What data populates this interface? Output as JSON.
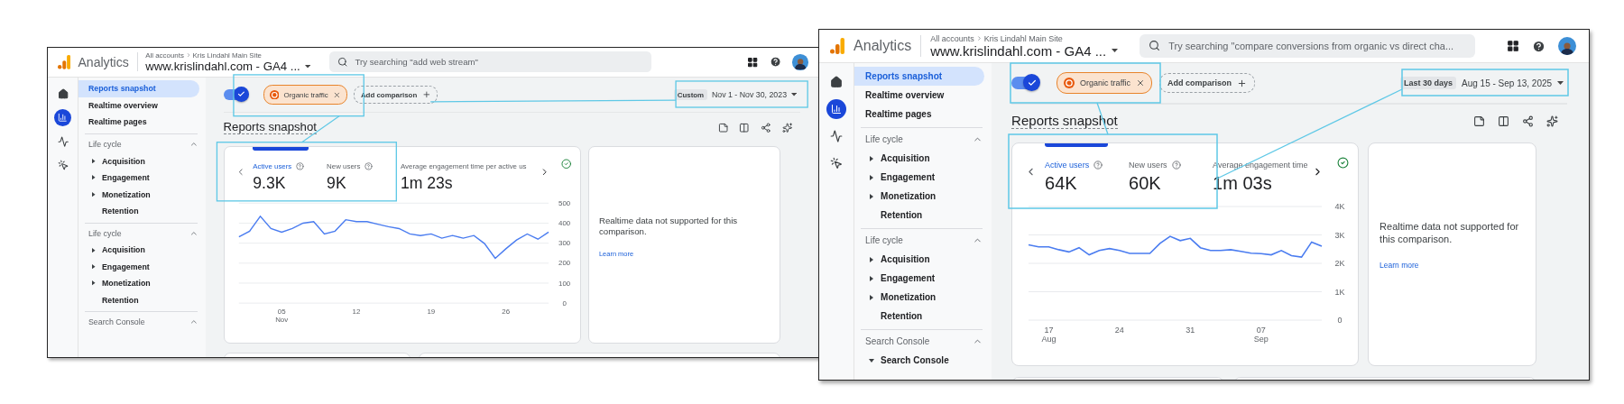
{
  "panels": [
    {
      "header": {
        "app_name": "Analytics",
        "breadcrumb": [
          "All accounts",
          "Kris Lindahl Main Site"
        ],
        "property": "www.krislindahl.com - GA4 ...",
        "search_placeholder": "Try searching \"add web stream\""
      },
      "rail": [
        {
          "kind": "home",
          "selected": false
        },
        {
          "kind": "reports",
          "selected": true
        },
        {
          "kind": "explore",
          "selected": false
        },
        {
          "kind": "advertising",
          "selected": false
        }
      ],
      "nav": {
        "items": [
          {
            "label": "Reports snapshot",
            "selected": true
          },
          {
            "label": "Realtime overview",
            "selected": false
          },
          {
            "label": "Realtime pages",
            "selected": false
          }
        ],
        "sections": [
          {
            "title": "Life cycle",
            "expanded": true,
            "items": [
              {
                "label": "Acquisition",
                "kind": "group",
                "expanded": false
              },
              {
                "label": "Engagement",
                "kind": "group",
                "expanded": false
              },
              {
                "label": "Monetization",
                "kind": "group",
                "expanded": false
              },
              {
                "label": "Retention",
                "kind": "page"
              }
            ]
          },
          {
            "title": "Life cycle",
            "expanded": true,
            "items": [
              {
                "label": "Acquisition",
                "kind": "group",
                "expanded": false
              },
              {
                "label": "Engagement",
                "kind": "group",
                "expanded": false
              },
              {
                "label": "Monetization",
                "kind": "group",
                "expanded": false
              },
              {
                "label": "Retention",
                "kind": "page"
              }
            ]
          },
          {
            "title": "Search Console",
            "expanded": true
          }
        ]
      },
      "comparison": {
        "enabled": true,
        "chips": [
          {
            "label": "Organic traffic"
          }
        ],
        "add_label": "Add comparison"
      },
      "date_range": {
        "preset": "Custom",
        "range": "Nov 1 - Nov 30, 2023"
      },
      "title": "Reports snapshot",
      "metrics": [
        {
          "label": "Active users",
          "value": "9.3K",
          "selected": true,
          "help": true
        },
        {
          "label": "New users",
          "value": "9K",
          "selected": false,
          "help": true
        },
        {
          "label": "Average engagement time per active us",
          "value": "1m 23s",
          "selected": false,
          "help": false
        }
      ],
      "chart_data": {
        "type": "line",
        "x": [
          "2023-11-01",
          "2023-11-02",
          "2023-11-03",
          "2023-11-04",
          "2023-11-05",
          "2023-11-06",
          "2023-11-07",
          "2023-11-08",
          "2023-11-09",
          "2023-11-10",
          "2023-11-11",
          "2023-11-12",
          "2023-11-13",
          "2023-11-14",
          "2023-11-15",
          "2023-11-16",
          "2023-11-17",
          "2023-11-18",
          "2023-11-19",
          "2023-11-20",
          "2023-11-21",
          "2023-11-22",
          "2023-11-23",
          "2023-11-24",
          "2023-11-25",
          "2023-11-26",
          "2023-11-27",
          "2023-11-28",
          "2023-11-29",
          "2023-11-30"
        ],
        "xlim": [
          "2023-11-01",
          "2023-11-30"
        ],
        "grid": true,
        "ylim": [
          0,
          500
        ],
        "yticks": [
          0,
          100,
          200,
          300,
          400,
          500
        ],
        "xticks": [
          {
            "value": "2023-11-05",
            "label": "05 Nov"
          },
          {
            "value": "2023-11-12",
            "label": "12"
          },
          {
            "value": "2023-11-19",
            "label": "19"
          },
          {
            "value": "2023-11-26",
            "label": "26"
          }
        ],
        "series": [
          {
            "color": "#4a7cf0",
            "values": [
              332,
              360,
              434,
              373,
              355,
              373,
              400,
              408,
              346,
              360,
              417,
              408,
              408,
              395,
              382,
              373,
              346,
              338,
              346,
              325,
              338,
              325,
              338,
              298,
              224,
              272,
              316,
              346,
              320,
              355
            ]
          }
        ]
      },
      "realtime": {
        "message": "Realtime data not supported for this comparison.",
        "link": "Learn more"
      }
    },
    {
      "header": {
        "app_name": "Analytics",
        "breadcrumb": [
          "All accounts",
          "Kris Lindahl Main Site"
        ],
        "property": "www.krislindahl.com - GA4 ...",
        "search_placeholder": "Try searching \"compare conversions from organic vs direct cha..."
      },
      "rail": [
        {
          "kind": "home",
          "selected": false
        },
        {
          "kind": "reports",
          "selected": true
        },
        {
          "kind": "explore",
          "selected": false
        },
        {
          "kind": "advertising",
          "selected": false
        }
      ],
      "nav": {
        "items": [
          {
            "label": "Reports snapshot",
            "selected": true
          },
          {
            "label": "Realtime overview",
            "selected": false
          },
          {
            "label": "Realtime pages",
            "selected": false
          }
        ],
        "sections": [
          {
            "title": "Life cycle",
            "expanded": true,
            "items": [
              {
                "label": "Acquisition",
                "kind": "group",
                "expanded": false
              },
              {
                "label": "Engagement",
                "kind": "group",
                "expanded": false
              },
              {
                "label": "Monetization",
                "kind": "group",
                "expanded": false
              },
              {
                "label": "Retention",
                "kind": "page"
              }
            ]
          },
          {
            "title": "Life cycle",
            "expanded": true,
            "items": [
              {
                "label": "Acquisition",
                "kind": "group",
                "expanded": false
              },
              {
                "label": "Engagement",
                "kind": "group",
                "expanded": false
              },
              {
                "label": "Monetization",
                "kind": "group",
                "expanded": false
              },
              {
                "label": "Retention",
                "kind": "page"
              }
            ]
          },
          {
            "title": "Search Console",
            "expanded": true,
            "items": [
              {
                "label": "Search Console",
                "kind": "group",
                "expanded": true
              }
            ]
          }
        ]
      },
      "comparison": {
        "enabled": true,
        "chips": [
          {
            "label": "Organic traffic"
          }
        ],
        "add_label": "Add comparison"
      },
      "date_range": {
        "preset": "Last 30 days",
        "range": "Aug 15 - Sep 13, 2025"
      },
      "title": "Reports snapshot",
      "metrics": [
        {
          "label": "Active users",
          "value": "64K",
          "selected": true,
          "help": true
        },
        {
          "label": "New users",
          "value": "60K",
          "selected": false,
          "help": true
        },
        {
          "label": "Average engagement time",
          "value": "1m 03s",
          "selected": false,
          "help": false
        }
      ],
      "chart_data": {
        "type": "line",
        "x": [
          "2025-08-15",
          "2025-08-16",
          "2025-08-17",
          "2025-08-18",
          "2025-08-19",
          "2025-08-20",
          "2025-08-21",
          "2025-08-22",
          "2025-08-23",
          "2025-08-24",
          "2025-08-25",
          "2025-08-26",
          "2025-08-27",
          "2025-08-28",
          "2025-08-29",
          "2025-08-30",
          "2025-08-31",
          "2025-09-01",
          "2025-09-02",
          "2025-09-03",
          "2025-09-04",
          "2025-09-05",
          "2025-09-06",
          "2025-09-07",
          "2025-09-08",
          "2025-09-09",
          "2025-09-10",
          "2025-09-11",
          "2025-09-12",
          "2025-09-13"
        ],
        "xlim": [
          "2025-08-15",
          "2025-09-13"
        ],
        "grid": true,
        "ylim": [
          0,
          4000
        ],
        "yticks": [
          {
            "value": 0,
            "label": "0"
          },
          {
            "value": 1000,
            "label": "1K"
          },
          {
            "value": 2000,
            "label": "2K"
          },
          {
            "value": 3000,
            "label": "3K"
          },
          {
            "value": 4000,
            "label": "4K"
          }
        ],
        "xticks": [
          {
            "value": "2025-08-17",
            "label": "17 Aug"
          },
          {
            "value": "2025-08-24",
            "label": "24"
          },
          {
            "value": "2025-08-31",
            "label": "31"
          },
          {
            "value": "2025-09-07",
            "label": "07 Sep"
          }
        ],
        "series": [
          {
            "color": "#4a7cf0",
            "values": [
              2650,
              2580,
              2580,
              2480,
              2400,
              2550,
              2300,
              2450,
              2520,
              2450,
              2350,
              2350,
              2350,
              2700,
              2950,
              2800,
              2880,
              2550,
              2450,
              2450,
              2480,
              2420,
              2360,
              2340,
              2300,
              2450,
              2270,
              2220,
              2750,
              2600
            ]
          }
        ]
      },
      "realtime": {
        "message": "Realtime data not supported for this comparison.",
        "link": "Learn more"
      }
    }
  ]
}
